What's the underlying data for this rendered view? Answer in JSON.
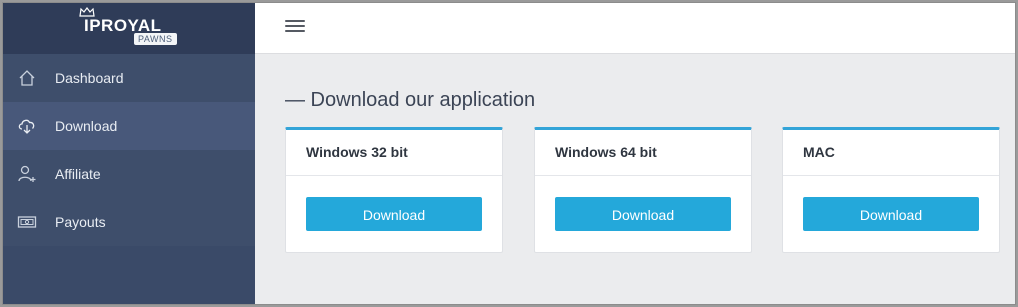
{
  "brand": {
    "wordmark": "IPROYAL",
    "badge": "PAWNS"
  },
  "sidebar": {
    "items": [
      {
        "label": "Dashboard",
        "icon": "home-icon",
        "active": false
      },
      {
        "label": "Download",
        "icon": "cloud-download-icon",
        "active": true
      },
      {
        "label": "Affiliate",
        "icon": "user-plus-icon",
        "active": false
      },
      {
        "label": "Payouts",
        "icon": "money-icon",
        "active": false
      }
    ]
  },
  "topbar": {
    "menu_icon": "hamburger-icon"
  },
  "main": {
    "section_title": "— Download our application",
    "cards": [
      {
        "title": "Windows 32 bit",
        "button_label": "Download"
      },
      {
        "title": "Windows 64 bit",
        "button_label": "Download"
      },
      {
        "title": "MAC",
        "button_label": "Download"
      }
    ]
  },
  "colors": {
    "sidebar_bg": "#3a4a68",
    "sidebar_active": "#48587a",
    "accent": "#24a8da",
    "card_top_border": "#33a4d8"
  }
}
